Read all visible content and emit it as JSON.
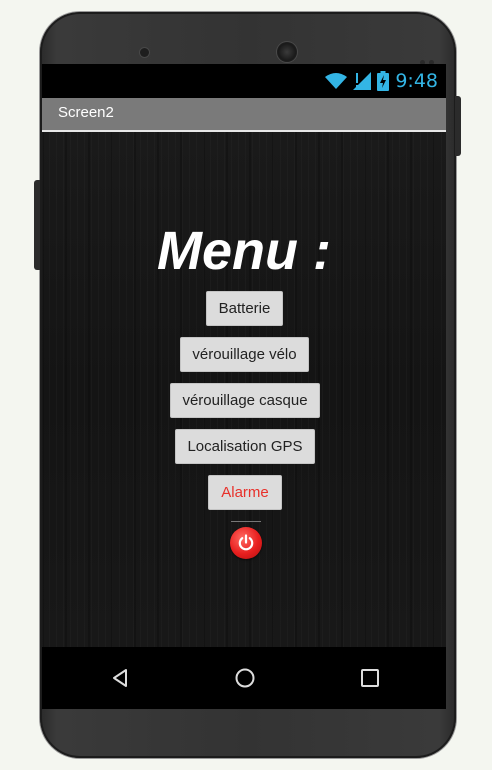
{
  "status_bar": {
    "time": "9:48",
    "icons": [
      "wifi-icon",
      "signal-icon",
      "battery-charging-icon"
    ],
    "accent_color": "#33b5e5"
  },
  "title_bar": {
    "title": "Screen2"
  },
  "main": {
    "heading": "Menu :",
    "buttons": [
      {
        "label": "Batterie"
      },
      {
        "label": "vérouillage vélo"
      },
      {
        "label": "vérouillage casque"
      },
      {
        "label": "Localisation GPS"
      },
      {
        "label": "Alarme",
        "color": "#e8302a"
      }
    ],
    "power_button": {
      "icon": "power-icon",
      "color": "#e81f1f"
    }
  },
  "nav_bar": {
    "icons": [
      "back-icon",
      "home-icon",
      "recents-icon"
    ]
  }
}
